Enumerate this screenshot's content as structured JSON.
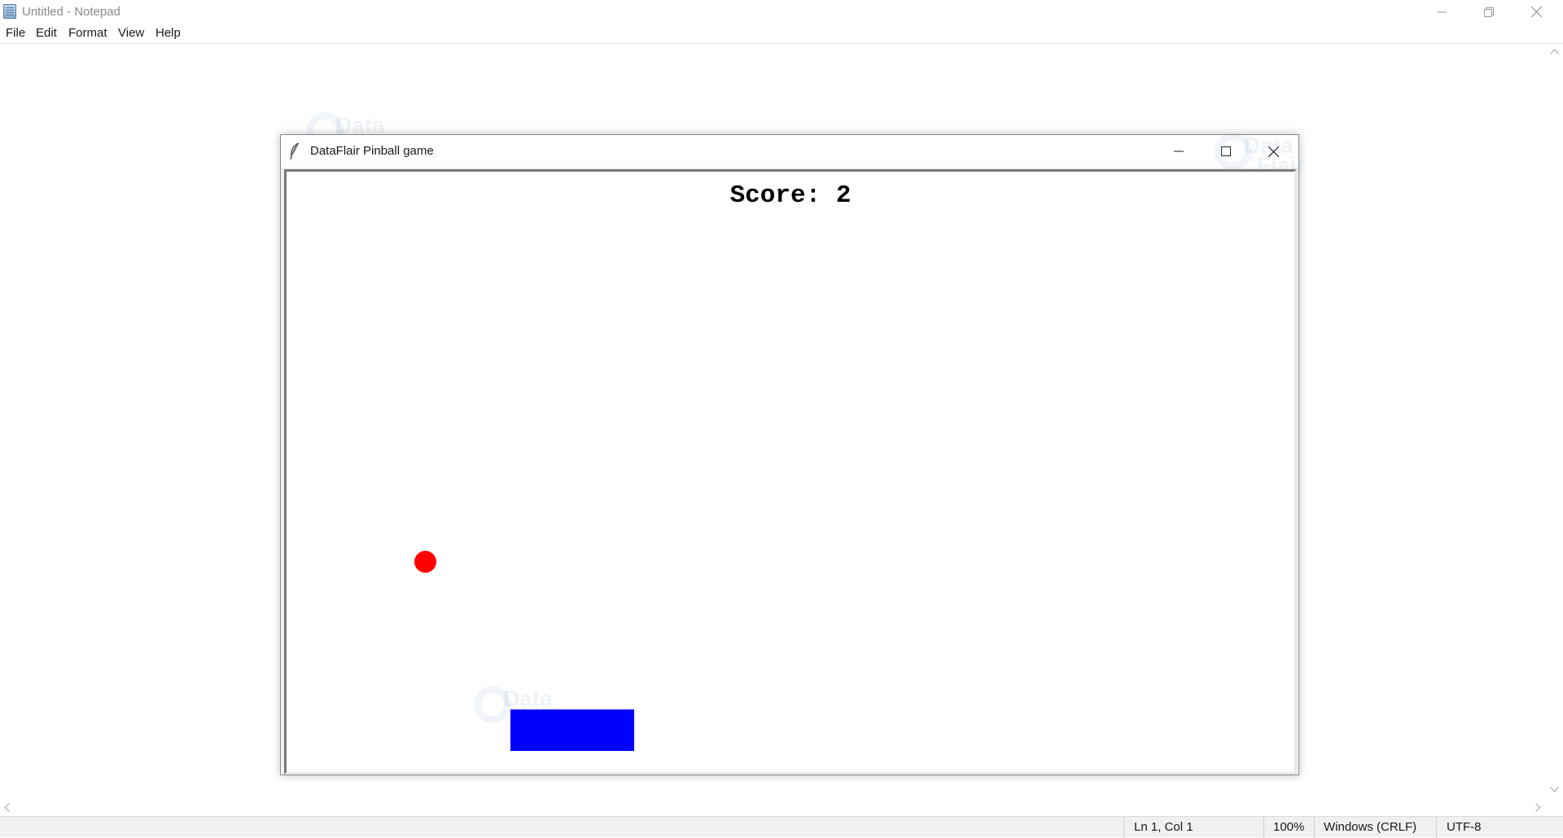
{
  "notepad": {
    "title": "Untitled - Notepad",
    "menu": [
      "File",
      "Edit",
      "Format",
      "View",
      "Help"
    ],
    "status": {
      "position": "Ln 1, Col 1",
      "zoom": "100%",
      "line_ending": "Windows (CRLF)",
      "encoding": "UTF-8"
    }
  },
  "game": {
    "title": "DataFlair Pinball game",
    "score_label": "Score:",
    "score_value": "2",
    "ball_color": "#ff0000",
    "paddle_color": "#0000ff"
  },
  "watermark": {
    "line1": "Data",
    "line2": "Flair"
  },
  "icons": {
    "notepad_app": "notepad-icon",
    "tk_app": "feather-icon",
    "minimize": "minimize-icon",
    "maximize": "maximize-icon",
    "restore": "restore-icon",
    "close": "close-icon"
  }
}
